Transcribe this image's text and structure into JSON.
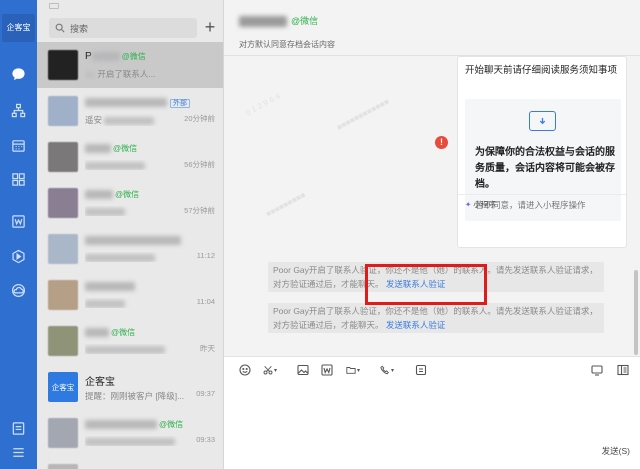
{
  "rail": {
    "logo": "企客宝",
    "icons": [
      "chat-icon",
      "org-icon",
      "calendar-icon",
      "apps-icon",
      "word-icon",
      "play-icon",
      "cloud-icon",
      "notes-icon",
      "menu-icon"
    ]
  },
  "list": {
    "search_placeholder": "搜索",
    "add_label": "+",
    "items": [
      {
        "name": "P",
        "wx": "@微信",
        "preview": "开启了联系人...",
        "time": "",
        "tag": ""
      },
      {
        "name": "",
        "wx": "",
        "tag": "外部",
        "preview": "遥安",
        "time": "20分钟前"
      },
      {
        "name": "",
        "wx": "@微信",
        "tag": "",
        "preview": "",
        "time": "56分钟前"
      },
      {
        "name": "",
        "wx": "@微信",
        "tag": "",
        "preview": "",
        "time": "57分钟前"
      },
      {
        "name": "",
        "wx": "",
        "tag": "",
        "preview": "",
        "time": "11:12"
      },
      {
        "name": "",
        "wx": "",
        "tag": "",
        "preview": "",
        "time": "11:04"
      },
      {
        "name": "",
        "wx": "@微信",
        "tag": "",
        "preview": "",
        "time": "昨天"
      },
      {
        "name": "企客宝",
        "wx": "",
        "tag": "",
        "preview": "提醒：刚刚被客户 [降级]...",
        "time": "09:37",
        "logo": "企客宝"
      },
      {
        "name": "",
        "wx": "@微信",
        "tag": "",
        "preview": "",
        "time": "09:33"
      }
    ]
  },
  "chat": {
    "title_wx": "@微信",
    "subtitle": "对方默认同意存档会话内容",
    "card": {
      "title": "开始聊天前请仔细阅读服务须知事项",
      "notice": "为保障你的合法权益与会话的服务质量，会话内容将可能会被存档。",
      "notice2": "若不同意，请进入小程序操作",
      "mini": "小程序"
    },
    "sys_msgs": [
      {
        "text": "Poor Gay开启了联系人验证，你还不是他（她）的联系人。请先发送联系人验证请求，对方验证通过后，才能聊天。",
        "link": "发送联系人验证"
      },
      {
        "text": "Poor Gay开启了联系人验证，你还不是他（她）的联系人。请先发送联系人验证请求，对方验证通过后，才能聊天。",
        "link": "发送联系人验证"
      }
    ],
    "error_icon": "!"
  },
  "toolbar": {
    "icons": [
      "emoji-icon",
      "scissors-icon",
      "image-icon",
      "word-icon",
      "folder-icon",
      "phone-icon",
      "archive-icon",
      "screen-icon",
      "layout-icon"
    ]
  },
  "input": {
    "send_label": "发送(S)"
  },
  "colors": {
    "rail": "#2f6fd0",
    "accent": "#3a7be0",
    "wechat_green": "#2bb04a",
    "highlight_red": "#e11b1b"
  }
}
